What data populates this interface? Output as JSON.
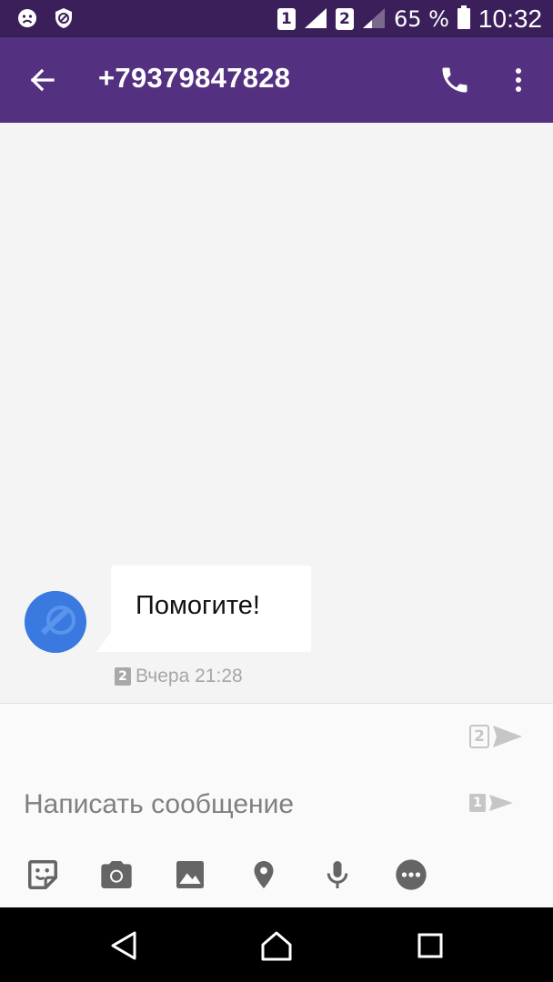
{
  "status_bar": {
    "sim1_label": "1",
    "sim2_label": "2",
    "battery_percent": "65 %",
    "time": "10:32",
    "icons": [
      "sad-face-icon",
      "shield-block-icon",
      "signal-icon",
      "battery-icon"
    ]
  },
  "app_bar": {
    "title": "+79379847828",
    "icons": [
      "back-arrow-icon",
      "phone-icon",
      "overflow-menu-icon"
    ]
  },
  "conversation": {
    "messages": [
      {
        "text": "Помогите!",
        "sim": "2",
        "time": "Вчера 21:28",
        "direction": "incoming"
      }
    ]
  },
  "composer": {
    "placeholder": "Написать сообщение",
    "send_sim2_label": "2",
    "send_sim1_label": "1",
    "toolbar_icons": [
      "sticker-icon",
      "camera-icon",
      "image-icon",
      "location-icon",
      "microphone-icon",
      "more-icon"
    ]
  },
  "nav_bar": {
    "icons": [
      "back-triangle-icon",
      "home-icon",
      "recents-icon"
    ]
  },
  "colors": {
    "status_bar": "#3a1f5a",
    "app_bar": "#533080",
    "avatar": "#3a7ae0",
    "background": "#f4f4f4"
  }
}
